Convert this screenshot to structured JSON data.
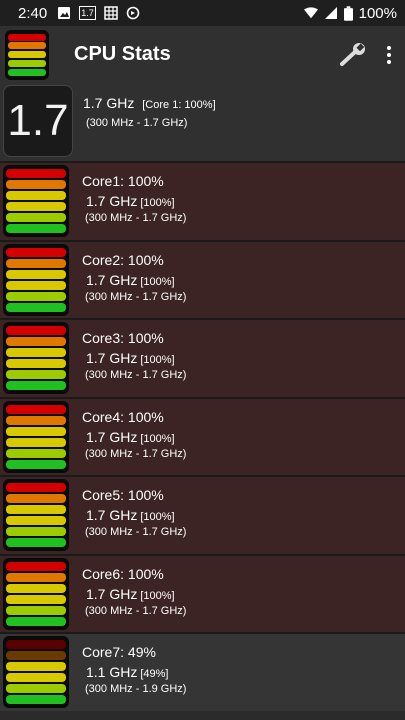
{
  "status_bar": {
    "time": "2:40",
    "notif_badge": "1.7",
    "battery": "100%"
  },
  "app_bar": {
    "title": "CPU Stats",
    "settings_icon": "wrench-icon",
    "menu_icon": "more-vert-icon"
  },
  "summary": {
    "big_value": "1.7",
    "freq": "1.7 GHz",
    "core_detail": "[Core 1: 100%]",
    "range": "(300 MHz - 1.7 GHz)"
  },
  "meter_colors": {
    "red": "#d40000",
    "orange": "#e07800",
    "yellow": "#d8c800",
    "lime": "#9ccc00",
    "green": "#20c020",
    "dim_red": "#5a0000",
    "dim_orange": "#6a3a00"
  },
  "cores": [
    {
      "name": "Core1: 100%",
      "freq": "1.7 GHz",
      "pct": "[100%]",
      "range": "(300 MHz - 1.7 GHz)",
      "load": 1.0
    },
    {
      "name": "Core2: 100%",
      "freq": "1.7 GHz",
      "pct": "[100%]",
      "range": "(300 MHz - 1.7 GHz)",
      "load": 1.0
    },
    {
      "name": "Core3: 100%",
      "freq": "1.7 GHz",
      "pct": "[100%]",
      "range": "(300 MHz - 1.7 GHz)",
      "load": 1.0
    },
    {
      "name": "Core4: 100%",
      "freq": "1.7 GHz",
      "pct": "[100%]",
      "range": "(300 MHz - 1.7 GHz)",
      "load": 1.0
    },
    {
      "name": "Core5: 100%",
      "freq": "1.7 GHz",
      "pct": "[100%]",
      "range": "(300 MHz - 1.7 GHz)",
      "load": 1.0
    },
    {
      "name": "Core6: 100%",
      "freq": "1.7 GHz",
      "pct": "[100%]",
      "range": "(300 MHz - 1.7 GHz)",
      "load": 1.0
    },
    {
      "name": "Core7: 49%",
      "freq": "1.1 GHz",
      "pct": "[49%]",
      "range": "(300 MHz - 1.9 GHz)",
      "load": 0.49
    }
  ]
}
